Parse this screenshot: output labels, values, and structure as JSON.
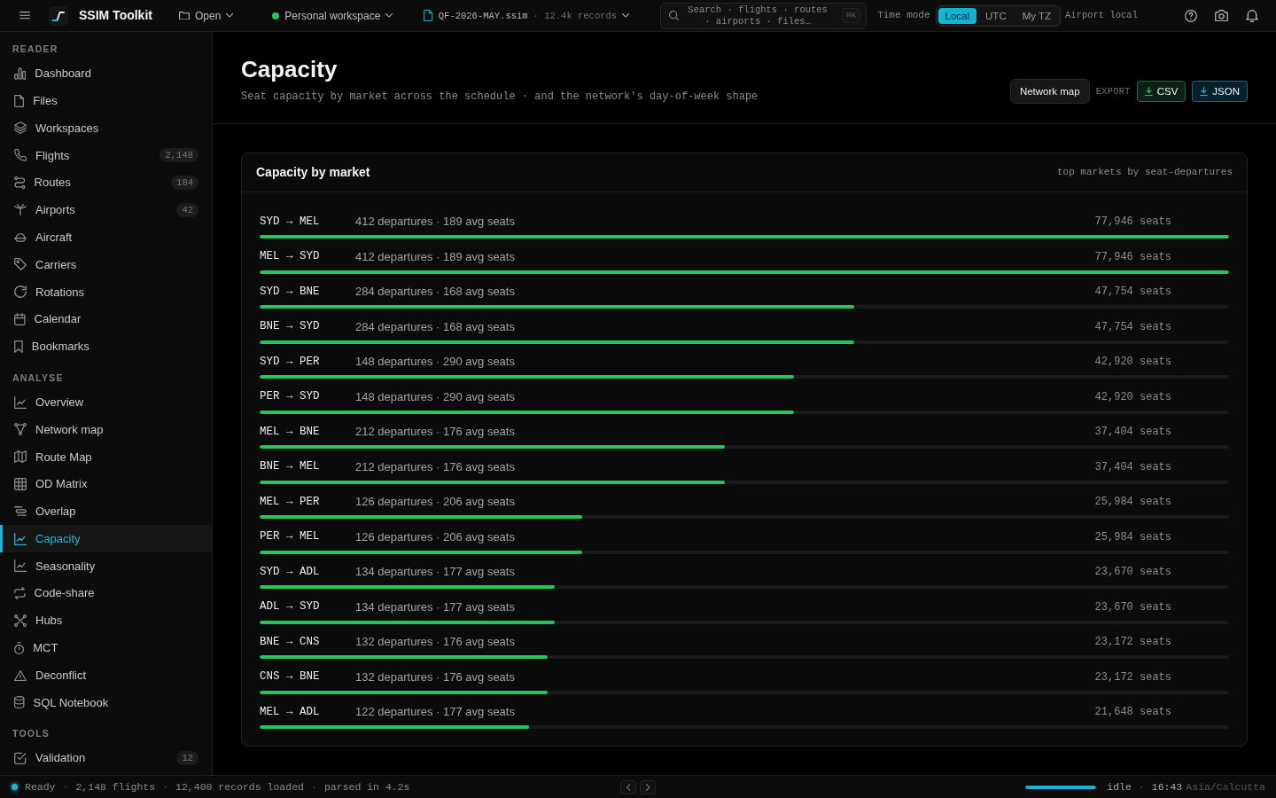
{
  "top_bar": {
    "app_name": "SSIM Toolkit",
    "open_menu": "Open",
    "workspace": "Personal workspace",
    "file": {
      "name": "QF-2026-MAY.ssim",
      "meta": "· 12.4k records"
    },
    "search": {
      "placeholder": "Search · flights · routes · airports · files…",
      "shortcut": "⌘K"
    },
    "time_mode": {
      "label": "Time mode",
      "options": [
        {
          "label": "Local",
          "selected": true
        },
        {
          "label": "UTC",
          "selected": false
        },
        {
          "label": "My TZ",
          "selected": false
        }
      ],
      "note": "Airport local"
    }
  },
  "sidebar": {
    "sections": [
      {
        "title": "READER",
        "items": [
          {
            "label": "Dashboard",
            "selected": false
          },
          {
            "label": "Files",
            "selected": false
          },
          {
            "label": "Workspaces",
            "selected": false
          },
          {
            "label": "Flights",
            "count": "2,148",
            "selected": false
          },
          {
            "label": "Routes",
            "count": "184",
            "selected": false
          },
          {
            "label": "Airports",
            "count": "42",
            "selected": false
          },
          {
            "label": "Aircraft",
            "selected": false
          },
          {
            "label": "Carriers",
            "selected": false
          },
          {
            "label": "Rotations",
            "selected": false
          },
          {
            "label": "Calendar",
            "selected": false
          },
          {
            "label": "Bookmarks",
            "selected": false
          }
        ]
      },
      {
        "title": "ANALYSE",
        "items": [
          {
            "label": "Overview",
            "selected": false
          },
          {
            "label": "Network map",
            "selected": false
          },
          {
            "label": "Route Map",
            "selected": false
          },
          {
            "label": "OD Matrix",
            "selected": false
          },
          {
            "label": "Overlap",
            "selected": false
          },
          {
            "label": "Capacity",
            "selected": true
          },
          {
            "label": "Seasonality",
            "selected": false
          },
          {
            "label": "Code-share",
            "selected": false
          },
          {
            "label": "Hubs",
            "selected": false
          },
          {
            "label": "MCT",
            "selected": false
          },
          {
            "label": "Deconflict",
            "selected": false
          },
          {
            "label": "SQL Notebook",
            "selected": false
          }
        ]
      },
      {
        "title": "TOOLS",
        "items": [
          {
            "label": "Validation",
            "count": "12",
            "selected": false
          }
        ]
      }
    ]
  },
  "page": {
    "title": "Capacity",
    "subtitle": "Seat capacity by market across the schedule · and the network's day-of-week shape",
    "network_map_button": "Network map",
    "export_label": "EXPORT",
    "exports": [
      {
        "label": "CSV",
        "kind": "csv"
      },
      {
        "label": "JSON",
        "kind": "json"
      }
    ]
  },
  "market_card": {
    "title": "Capacity by market",
    "note": "top markets by seat-departures",
    "rows": [
      {
        "route": "SYD → MEL",
        "detail": "412 departures · 189 avg seats",
        "seats": "77,946 seats",
        "level": 1
      },
      {
        "route": "MEL → SYD",
        "detail": "412 departures · 189 avg seats",
        "seats": "77,946 seats",
        "level": 1
      },
      {
        "route": "SYD → BNE",
        "detail": "284 departures · 168 avg seats",
        "seats": "47,754 seats",
        "level": 0.613
      },
      {
        "route": "BNE → SYD",
        "detail": "284 departures · 168 avg seats",
        "seats": "47,754 seats",
        "level": 0.613
      },
      {
        "route": "SYD → PER",
        "detail": "148 departures · 290 avg seats",
        "seats": "42,920 seats",
        "level": 0.551
      },
      {
        "route": "PER → SYD",
        "detail": "148 departures · 290 avg seats",
        "seats": "42,920 seats",
        "level": 0.551
      },
      {
        "route": "MEL → BNE",
        "detail": "212 departures · 176 avg seats",
        "seats": "37,404 seats",
        "level": 0.48
      },
      {
        "route": "BNE → MEL",
        "detail": "212 departures · 176 avg seats",
        "seats": "37,404 seats",
        "level": 0.48
      },
      {
        "route": "MEL → PER",
        "detail": "126 departures · 206 avg seats",
        "seats": "25,984 seats",
        "level": 0.333
      },
      {
        "route": "PER → MEL",
        "detail": "126 departures · 206 avg seats",
        "seats": "25,984 seats",
        "level": 0.333
      },
      {
        "route": "SYD → ADL",
        "detail": "134 departures · 177 avg seats",
        "seats": "23,670 seats",
        "level": 0.304
      },
      {
        "route": "ADL → SYD",
        "detail": "134 departures · 177 avg seats",
        "seats": "23,670 seats",
        "level": 0.304
      },
      {
        "route": "BNE → CNS",
        "detail": "132 departures · 176 avg seats",
        "seats": "23,172 seats",
        "level": 0.297
      },
      {
        "route": "CNS → BNE",
        "detail": "132 departures · 176 avg seats",
        "seats": "23,172 seats",
        "level": 0.297
      },
      {
        "route": "MEL → ADL",
        "detail": "122 departures · 177 avg seats",
        "seats": "21,648 seats",
        "level": 0.278
      }
    ]
  },
  "status_bar": {
    "state": "Ready",
    "separator": "·",
    "items": [
      "2,148 flights",
      "12,400 records loaded",
      "parsed in 4.2s"
    ],
    "progress": {
      "level": 1
    },
    "activity": "idle",
    "time": "16:43",
    "timezone": "Asia/Calcutta"
  }
}
